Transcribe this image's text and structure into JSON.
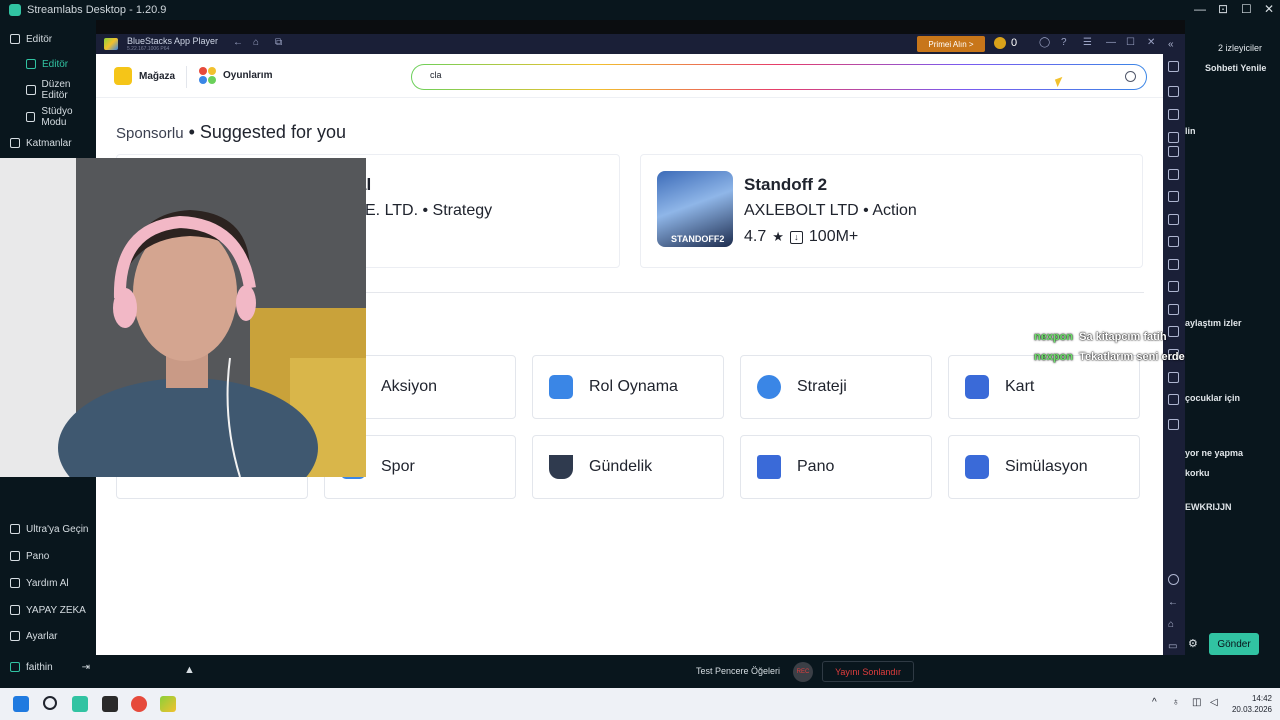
{
  "streamlabs": {
    "title": "Streamlabs Desktop - 1.20.9",
    "sidebar": {
      "items": [
        {
          "label": "Editör"
        },
        {
          "label": "Editör"
        },
        {
          "label": "Düzen Editör"
        },
        {
          "label": "Stüdyo Modu"
        },
        {
          "label": "Katmanlar"
        }
      ],
      "bottom": [
        {
          "label": "Ultra'ya Geçin"
        },
        {
          "label": "Pano"
        },
        {
          "label": "Yardım Al"
        },
        {
          "label": "YAPAY ZEKA"
        },
        {
          "label": "Ayarlar"
        },
        {
          "label": "faithin"
        }
      ]
    },
    "bottom_bar": {
      "test_label": "Test Pencere Öğeleri",
      "rec_label": "REC",
      "end_label": "Yayını Sonlandır"
    },
    "chat": {
      "viewers": "2 izleyiciler",
      "refresh": "Sohbeti Yenile",
      "lines": [
        "lin",
        "aylaştım izler",
        "çocuklar için",
        "yor ne yapma",
        "korku",
        "EWKRIJJN"
      ],
      "send_label": "Gönder"
    },
    "overlay_messages": [
      {
        "user": "nexpon",
        "text": "Sa kitapcım fatih"
      },
      {
        "user": "nexpon",
        "text": "Tekatlarım seni erde"
      }
    ]
  },
  "bluestacks": {
    "title": "BlueStacks App Player",
    "version": "5.22.167.1006 P64",
    "premium_label": "Primei Alın >",
    "coins": "0",
    "tabs": {
      "store": "Mağaza",
      "games": "Oyunlarım"
    },
    "search": {
      "value": "cla"
    },
    "section": {
      "sponsored": "Sponsorlu",
      "title": "Suggested for you"
    },
    "apps": [
      {
        "title": "al",
        "meta": "E. LTD. • Strategy"
      },
      {
        "title": "Standoff 2",
        "meta": "AXLEBOLT LTD • Action",
        "rating": "4.7",
        "downloads": "100M+",
        "icon_label": "STANDOFF2"
      }
    ],
    "categories": [
      {
        "label": "Aksiyon",
        "icon": "action-icon",
        "color": "#3a86e6"
      },
      {
        "label": "Rol Oynama",
        "icon": "roleplay-icon",
        "color": "#3a86e6"
      },
      {
        "label": "Strateji",
        "icon": "strategy-icon",
        "color": "#3a86e6"
      },
      {
        "label": "Kart",
        "icon": "card-icon",
        "color": "#3a6ad8"
      },
      {
        "label": "Spor",
        "icon": "sports-icon",
        "color": "#3a86e6"
      },
      {
        "label": "Gündelik",
        "icon": "casual-icon",
        "color": "#2f3a4e"
      },
      {
        "label": "Pano",
        "icon": "board-icon",
        "color": "#3a6ad8"
      },
      {
        "label": "Simülasyon",
        "icon": "simulation-icon",
        "color": "#3a6ad8"
      }
    ]
  },
  "taskbar": {
    "time": "14:42",
    "date": "20.03.2026"
  }
}
